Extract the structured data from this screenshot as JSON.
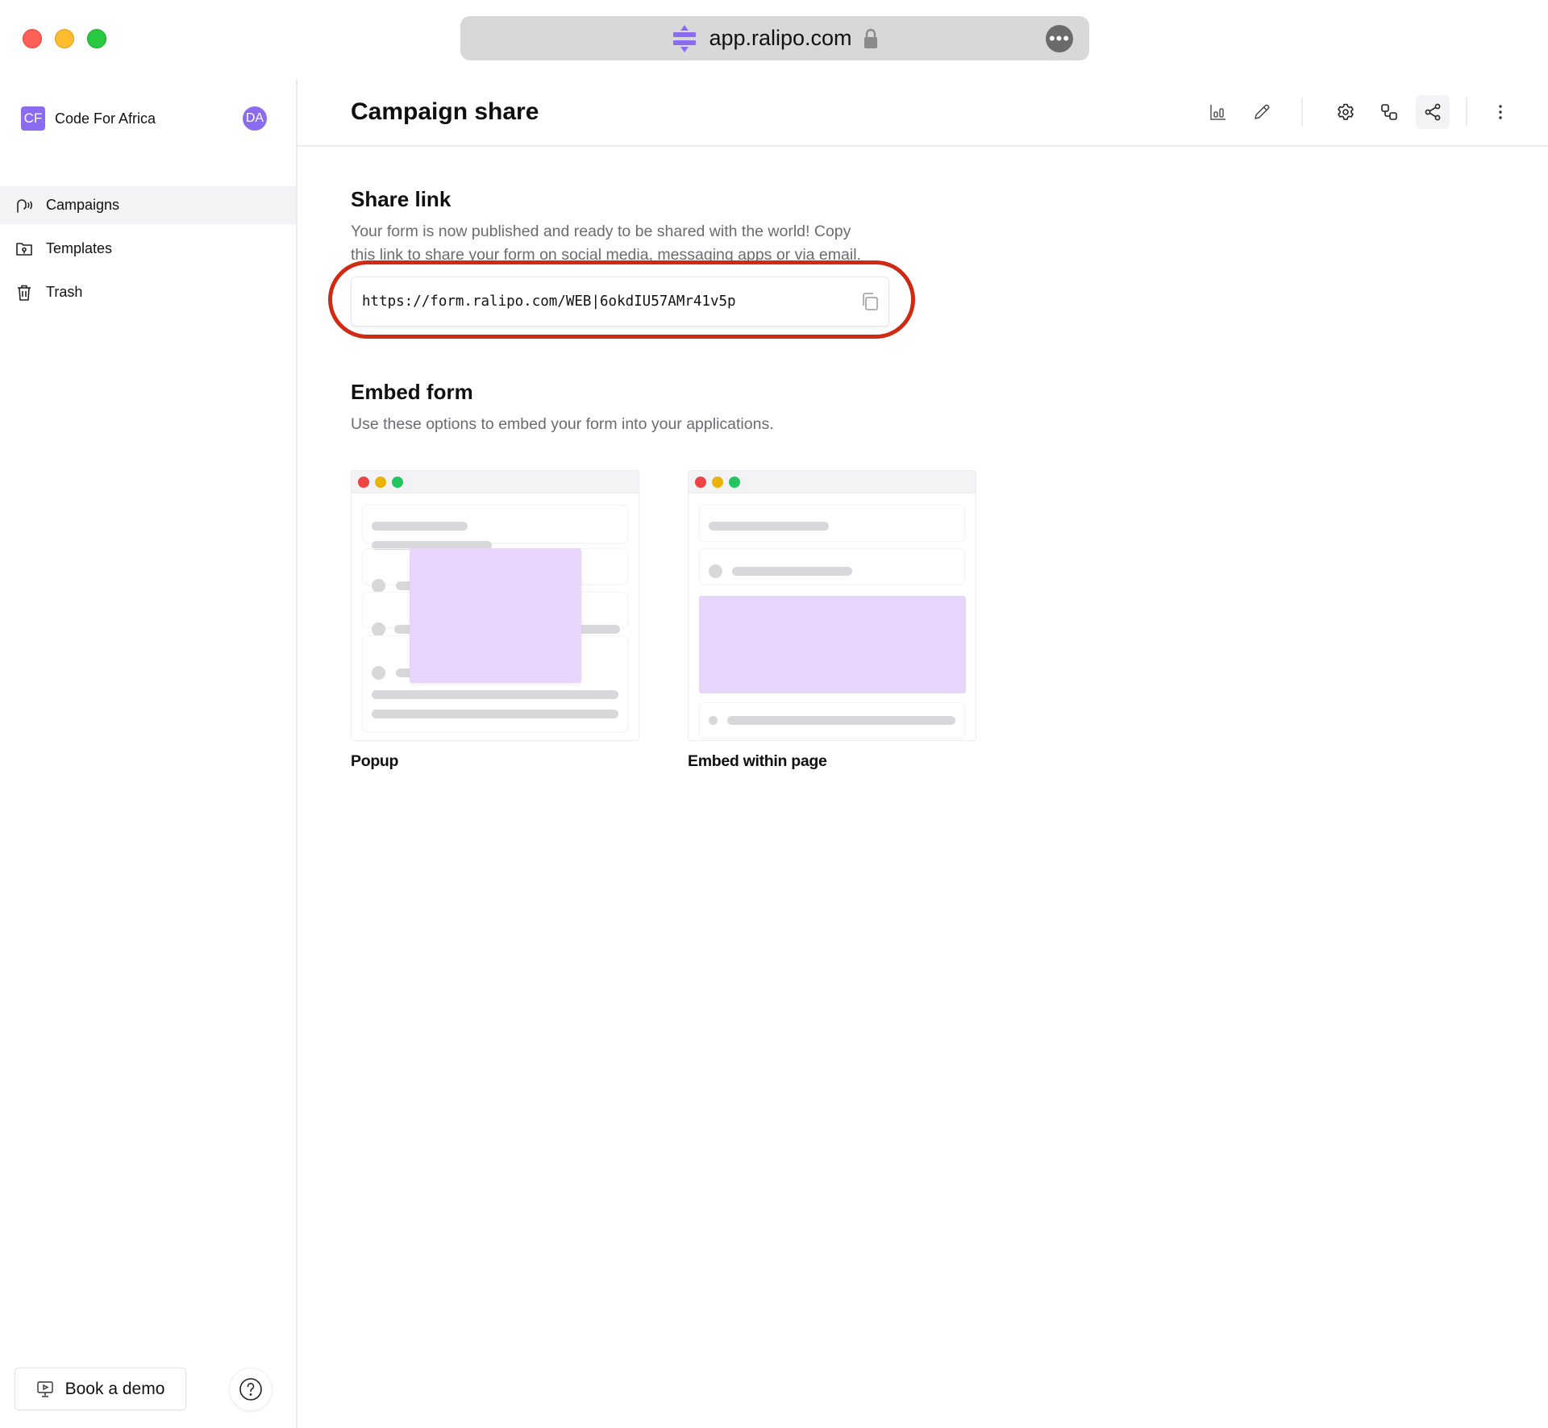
{
  "browser": {
    "url": "app.ralipo.com",
    "logo_icon": "ralipo-logo-icon",
    "lock_icon": "lock-icon",
    "more_icon": "ellipsis-icon",
    "more_label": "•••",
    "colors": {
      "red": "#fe5f57",
      "yellow": "#febc2e",
      "green": "#28c840",
      "brand": "#8b6cf0"
    }
  },
  "sidebar": {
    "org": {
      "initials": "CF",
      "name": "Code For Africa"
    },
    "user": {
      "initials": "DA"
    },
    "items": [
      {
        "label": "Campaigns",
        "icon": "campaign-broadcast-icon",
        "active": true
      },
      {
        "label": "Templates",
        "icon": "folder-template-icon",
        "active": false
      },
      {
        "label": "Trash",
        "icon": "trash-icon",
        "active": false
      }
    ],
    "book_demo_label": "Book a demo",
    "help_icon": "question-circle-icon"
  },
  "header": {
    "title": "Campaign share",
    "toolbar": [
      {
        "name": "analytics",
        "icon": "bar-chart-icon"
      },
      {
        "name": "edit",
        "icon": "pencil-icon"
      },
      {
        "name": "settings",
        "icon": "gear-icon"
      },
      {
        "name": "integrations",
        "icon": "workflow-icon"
      },
      {
        "name": "share",
        "icon": "share-icon",
        "active": true
      },
      {
        "name": "more",
        "icon": "more-vertical-icon"
      }
    ]
  },
  "share": {
    "title": "Share link",
    "description": "Your form is now published and ready to be shared with the world! Copy this link to share your form on social media, messaging apps or via email.",
    "link": "https://form.ralipo.com/WEB|6okdIU57AMr41v5p",
    "copy_icon": "copy-icon",
    "highlight_color": "#d12a12"
  },
  "embed": {
    "title": "Embed form",
    "description": "Use these options to embed your form into your applications.",
    "options": [
      {
        "label": "Popup"
      },
      {
        "label": "Embed within page"
      }
    ],
    "accent_color": "#e8d5fb"
  }
}
